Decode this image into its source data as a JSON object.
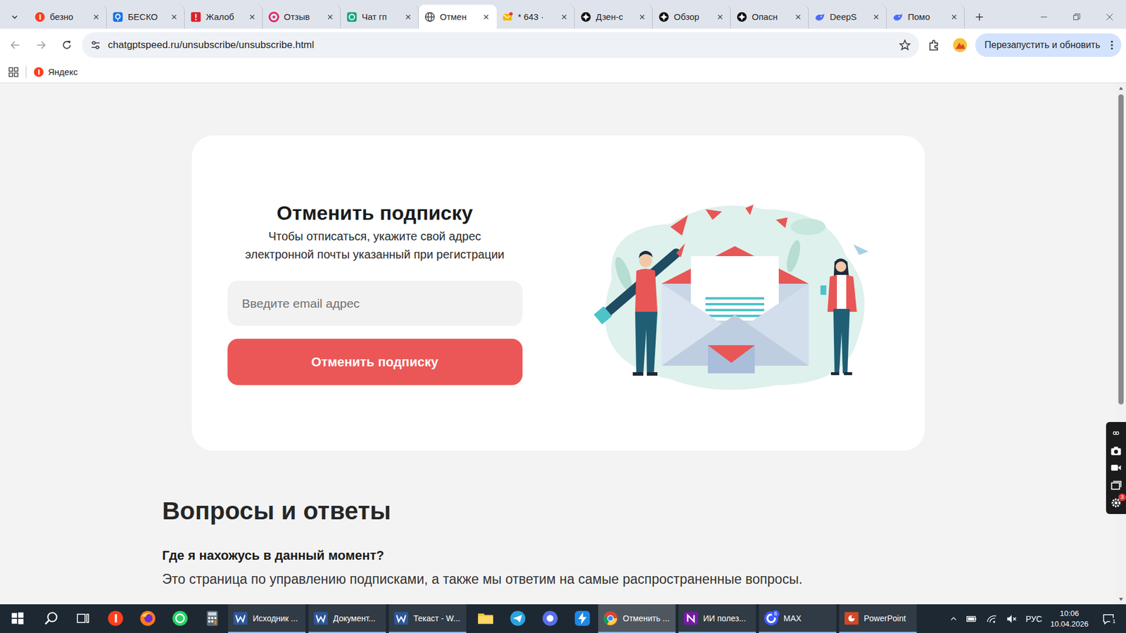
{
  "tabs": [
    {
      "label": "безно",
      "kind": "yandex",
      "selected": false
    },
    {
      "label": "БЕСКО",
      "kind": "help",
      "selected": false
    },
    {
      "label": "Жалоб",
      "kind": "alert",
      "selected": false
    },
    {
      "label": "Отзыв",
      "kind": "review",
      "selected": false
    },
    {
      "label": "Чат гп",
      "kind": "chat",
      "selected": false
    },
    {
      "label": "Отмен",
      "kind": "globe",
      "selected": true
    },
    {
      "label": "* 643 ·",
      "kind": "mail",
      "selected": false
    },
    {
      "label": "Дзен-с",
      "kind": "star",
      "selected": false
    },
    {
      "label": "Обзор",
      "kind": "star",
      "selected": false
    },
    {
      "label": "Опасн",
      "kind": "star",
      "selected": false
    },
    {
      "label": "DeepS",
      "kind": "deepseek",
      "selected": false
    },
    {
      "label": "Помо",
      "kind": "deepseek",
      "selected": false
    }
  ],
  "address_bar": {
    "url": "chatgptspeed.ru/unsubscribe/unsubscribe.html"
  },
  "update_button": {
    "label": "Перезапустить и обновить"
  },
  "bookmarks": [
    {
      "label": "Яндекс",
      "kind": "yandex"
    }
  ],
  "card": {
    "title": "Отменить подписку",
    "subtitle_lines": [
      "Чтобы отписаться, укажите свой адрес",
      "электронной почты указанный при регистрации"
    ],
    "email_placeholder": "Введите email адрес",
    "submit": "Отменить подписку"
  },
  "faq": {
    "title": "Вопросы и ответы",
    "items": [
      {
        "question": "Где я нахожусь в данный момент?",
        "answer": "Это страница по управлению подписками, а также мы ответим на самые распространенные вопросы."
      }
    ]
  },
  "scrollbar": {
    "level": 0.62
  },
  "side_toolbar": {
    "settings_badge": "3"
  },
  "taskbar": {
    "apps": [
      {
        "kind": "start",
        "label": "",
        "active": false
      },
      {
        "kind": "search",
        "label": "",
        "active": false
      },
      {
        "kind": "taskview",
        "label": "",
        "active": false
      },
      {
        "kind": "yandex",
        "label": "",
        "active": false
      },
      {
        "kind": "firefox",
        "label": "",
        "active": false
      },
      {
        "kind": "whatsapp",
        "label": "",
        "active": false
      },
      {
        "kind": "calculator",
        "label": "",
        "active": false
      },
      {
        "kind": "word",
        "label": "Исходник ...",
        "active": false
      },
      {
        "kind": "word",
        "label": "Документ...",
        "active": false
      },
      {
        "kind": "word",
        "label": "Текаст - W...",
        "active": false
      },
      {
        "kind": "explorer",
        "label": "",
        "active": false
      },
      {
        "kind": "telegram",
        "label": "",
        "active": false
      },
      {
        "kind": "bluecircle",
        "label": "",
        "active": false
      },
      {
        "kind": "bolt",
        "label": "",
        "active": false
      },
      {
        "kind": "chrome",
        "label": "Отменить ...",
        "active": true
      },
      {
        "kind": "onenote",
        "label": "ИИ полез...",
        "active": false
      },
      {
        "kind": "max",
        "label": "MAX",
        "active": false,
        "badge": "6"
      },
      {
        "kind": "powerpoint",
        "label": "PowerPoint",
        "active": false
      }
    ],
    "tray": {
      "language": "РУС",
      "time": "10:06",
      "date": "10.04.2026",
      "notifications": "1"
    }
  }
}
